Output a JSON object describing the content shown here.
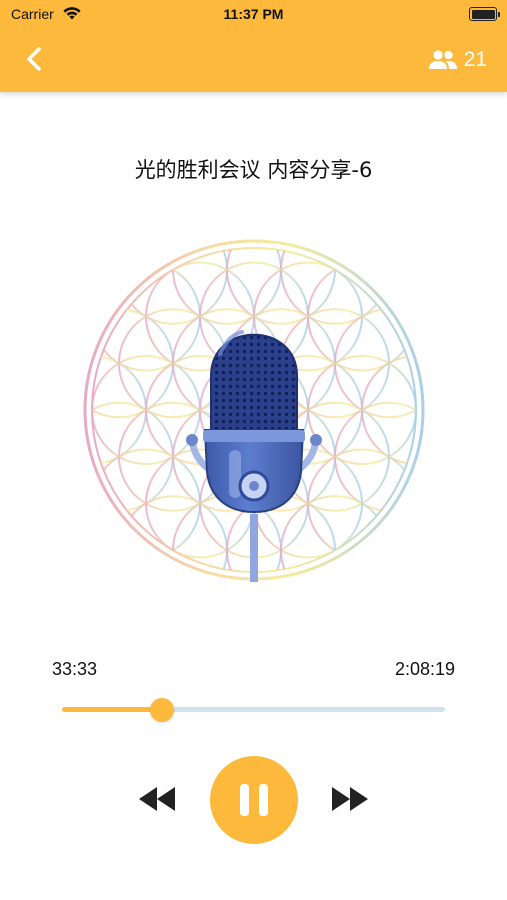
{
  "status_bar": {
    "carrier": "Carrier",
    "time": "11:37 PM",
    "wifi_icon": "wifi-icon",
    "battery_level": 1.0
  },
  "header": {
    "back_icon": "chevron-left-icon",
    "listeners_icon": "people-icon",
    "listener_count": "21",
    "background_color": "#fdb93c"
  },
  "track": {
    "title": "光的胜利会议 内容分享-6",
    "artwork_icon": "microphone-icon"
  },
  "player": {
    "elapsed": "33:33",
    "total": "2:08:19",
    "progress_fraction": 0.261,
    "state": "playing",
    "controls": {
      "rewind_icon": "rewind-icon",
      "pause_icon": "pause-icon",
      "forward_icon": "fast-forward-icon"
    }
  },
  "colors": {
    "accent": "#fdb93c",
    "track_inactive": "#cfe1f2",
    "mic_blue": "#2f4a9c"
  }
}
